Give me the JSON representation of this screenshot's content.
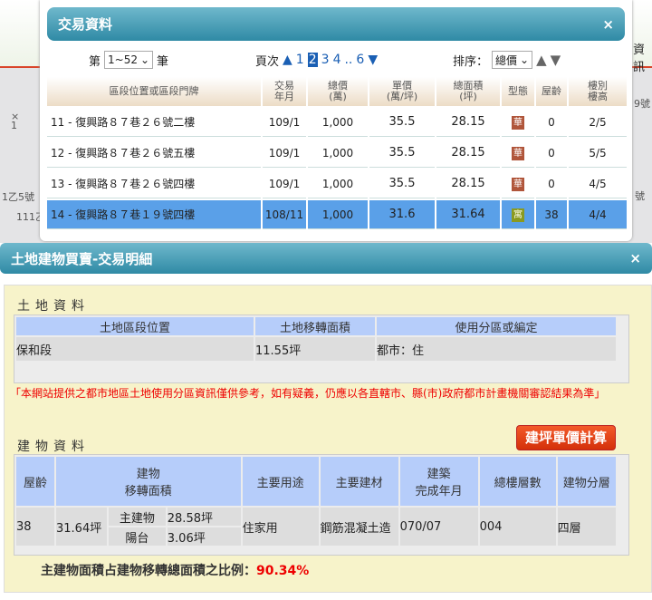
{
  "map": {
    "labels": [
      "×\n1",
      "1乙5號",
      "111乙",
      "資訊",
      "9號",
      "號"
    ]
  },
  "list_dialog": {
    "title": "交易資料",
    "close": "×",
    "range_prefix": "第",
    "range_value": "1~52",
    "range_suffix": "筆",
    "page_label": "頁次",
    "pages": [
      "1",
      "2",
      "3",
      "4",
      "..",
      "6"
    ],
    "current_page": "2",
    "sort_label": "排序：",
    "sort_value": "總價",
    "columns": [
      "區段位置或區段門牌",
      "交易\n年月",
      "總價\n(萬)",
      "單價\n(萬/坪)",
      "總面積\n(坪)",
      "型態",
      "屋齡",
      "樓別\n樓高"
    ],
    "rows": [
      {
        "addr": "11 - 復興路８７巷２６號二樓",
        "date": "109/1",
        "total": "1,000",
        "unit": "35.5",
        "area": "28.15",
        "type": "華",
        "age": "0",
        "floor": "2/5"
      },
      {
        "addr": "12 - 復興路８７巷２６號五樓",
        "date": "109/1",
        "total": "1,000",
        "unit": "35.5",
        "area": "28.15",
        "type": "華",
        "age": "0",
        "floor": "5/5"
      },
      {
        "addr": "13 - 復興路８７巷２６號四樓",
        "date": "109/1",
        "total": "1,000",
        "unit": "35.5",
        "area": "28.15",
        "type": "華",
        "age": "0",
        "floor": "4/5"
      },
      {
        "addr": "14 - 復興路８７巷１９號四樓",
        "date": "108/11",
        "total": "1,000",
        "unit": "31.6",
        "area": "31.64",
        "type": "寓",
        "age": "38",
        "floor": "4/4"
      }
    ]
  },
  "detail_dialog": {
    "title": "土地建物買賣-交易明細",
    "close": "×",
    "land_title": "土地資料",
    "land_cols": [
      "土地區段位置",
      "土地移轉面積",
      "使用分區或編定"
    ],
    "land_row": [
      "保和段",
      "11.55坪",
      "都市：住"
    ],
    "note": "「本網站提供之都市地區土地使用分區資訊僅供參考，如有疑義，仍應以各直轄市、縣(市)政府都市計畫機關審認結果為準」",
    "calc_button": "建坪單價計算",
    "bldg_title": "建物資料",
    "bldg_cols": [
      "屋齡",
      "建物\n移轉面積",
      "主要用途",
      "主要建材",
      "建築\n完成年月",
      "總樓層數",
      "建物分層"
    ],
    "bldg_row": {
      "age": "38",
      "area": "31.64坪",
      "main_label": "主建物",
      "main_val": "28.58坪",
      "balcony_label": "陽台",
      "balcony_val": "3.06坪",
      "use": "住家用",
      "material": "鋼筋混凝土造",
      "built": "070/07",
      "floors": "004",
      "layer": "四層"
    },
    "ratio_label": "主建物面積占建物移轉總面積之比例：",
    "ratio_value": "90.34%"
  }
}
